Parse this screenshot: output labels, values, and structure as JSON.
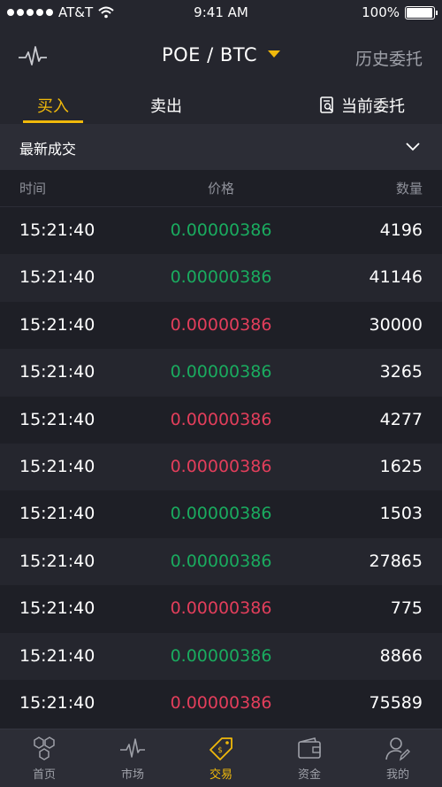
{
  "status_bar": {
    "carrier": "AT&T",
    "time": "9:41 AM",
    "battery": "100%",
    "battery_level": 1.0
  },
  "nav": {
    "title": "POE / BTC",
    "history_label": "历史委托"
  },
  "tabs": {
    "buy": "买入",
    "sell": "卖出",
    "current_orders": "当前委托"
  },
  "section": {
    "title": "最新成交"
  },
  "table": {
    "headers": {
      "time": "时间",
      "price": "价格",
      "qty": "数量"
    },
    "rows": [
      {
        "time": "15:21:40",
        "price": "0.00000386",
        "qty": "4196",
        "direction": "up"
      },
      {
        "time": "15:21:40",
        "price": "0.00000386",
        "qty": "41146",
        "direction": "up"
      },
      {
        "time": "15:21:40",
        "price": "0.00000386",
        "qty": "30000",
        "direction": "down"
      },
      {
        "time": "15:21:40",
        "price": "0.00000386",
        "qty": "3265",
        "direction": "up"
      },
      {
        "time": "15:21:40",
        "price": "0.00000386",
        "qty": "4277",
        "direction": "down"
      },
      {
        "time": "15:21:40",
        "price": "0.00000386",
        "qty": "1625",
        "direction": "down"
      },
      {
        "time": "15:21:40",
        "price": "0.00000386",
        "qty": "1503",
        "direction": "up"
      },
      {
        "time": "15:21:40",
        "price": "0.00000386",
        "qty": "27865",
        "direction": "up"
      },
      {
        "time": "15:21:40",
        "price": "0.00000386",
        "qty": "775",
        "direction": "down"
      },
      {
        "time": "15:21:40",
        "price": "0.00000386",
        "qty": "8866",
        "direction": "up"
      },
      {
        "time": "15:21:40",
        "price": "0.00000386",
        "qty": "75589",
        "direction": "down"
      }
    ]
  },
  "tabbar": {
    "items": [
      {
        "label": "首页",
        "icon": "hexagons-icon",
        "active": false
      },
      {
        "label": "市场",
        "icon": "pulse-icon",
        "active": false
      },
      {
        "label": "交易",
        "icon": "price-tag-icon",
        "active": true
      },
      {
        "label": "资金",
        "icon": "wallet-icon",
        "active": false
      },
      {
        "label": "我的",
        "icon": "user-edit-icon",
        "active": false
      }
    ]
  },
  "colors": {
    "accent": "#f0b90b",
    "up": "#1aab5f",
    "down": "#e23e5b",
    "background": "#1e1f26"
  }
}
